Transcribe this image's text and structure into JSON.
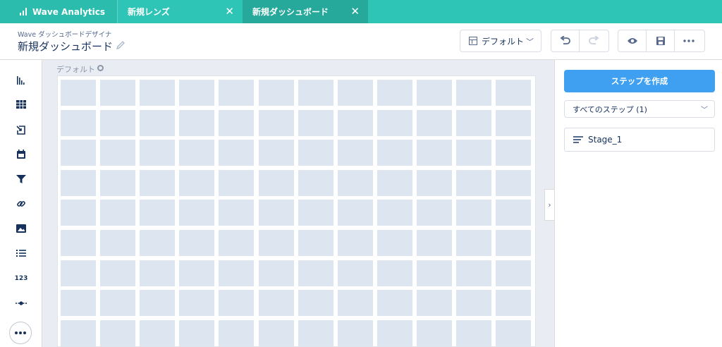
{
  "tabs": {
    "app": {
      "label": "Wave Analytics",
      "icon": "bar-chart-icon"
    },
    "items": [
      {
        "label": "新規レンズ",
        "close": "✕"
      },
      {
        "label": "新規ダッシュボード",
        "close": "✕",
        "active": true
      }
    ]
  },
  "header": {
    "subtitle": "Wave ダッシュボードデザイナ",
    "title": "新規ダッシュボード",
    "layout_select": {
      "label": "デフォルト",
      "icon": "layout-icon"
    },
    "actions": [
      "undo-icon",
      "redo-icon",
      "preview-icon",
      "save-icon",
      "more-icon"
    ]
  },
  "rail": {
    "widgets": [
      "chart-icon",
      "table-icon",
      "compare-table-icon",
      "date-icon",
      "filter-icon",
      "link-icon",
      "image-icon",
      "list-icon",
      "number-icon",
      "range-icon",
      "more-icon"
    ],
    "number_label": "123"
  },
  "canvas": {
    "layout_label": "デフォルト",
    "grid": {
      "columns": 12,
      "rows": 9
    }
  },
  "panel": {
    "create_step": "ステップを作成",
    "filter": {
      "selected": "すべてのステップ (1)"
    },
    "steps": [
      {
        "name": "Stage_1",
        "icon": "step-icon"
      }
    ]
  },
  "colors": {
    "tab_bar": "#2ec4b6",
    "active_tab": "#26a89b",
    "primary_button": "#3fa0f2",
    "grid_cell": "#dde6f0"
  }
}
